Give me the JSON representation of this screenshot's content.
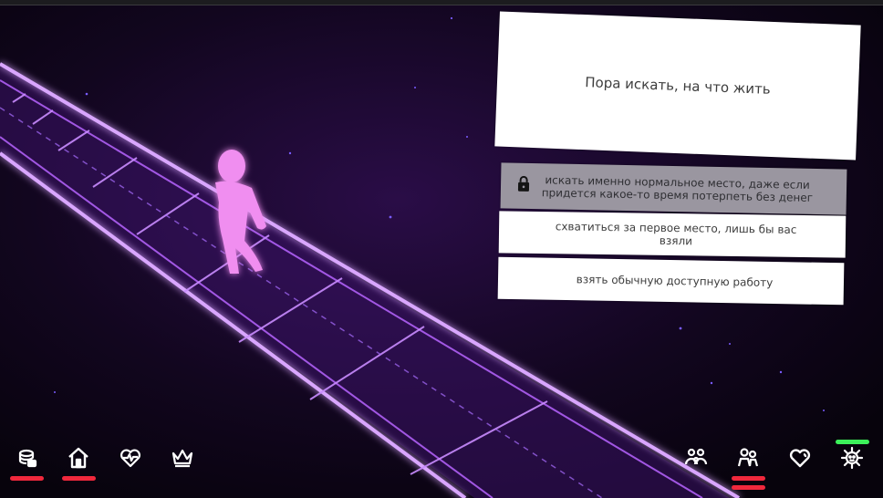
{
  "prompt": {
    "text": "Пора искать, на что жить"
  },
  "choices": [
    {
      "text": "искать именно нормальное место, даже если придется какое-то время потерпеть без денег",
      "locked": true,
      "icon": "lock-icon"
    },
    {
      "text": "схватиться за первое место, лишь бы вас взяли",
      "locked": false
    },
    {
      "text": "взять обычную доступную работу",
      "locked": false
    }
  ],
  "hud": {
    "left": [
      {
        "icon": "money-stack-icon",
        "indicator": "red"
      },
      {
        "icon": "home-icon",
        "indicator": "red"
      },
      {
        "icon": "heartbeat-icon",
        "indicator": "none"
      },
      {
        "icon": "crown-icon",
        "indicator": "none"
      }
    ],
    "right": [
      {
        "icon": "family-icon",
        "indicator": "none"
      },
      {
        "icon": "people-icon",
        "indicator": "red-double"
      },
      {
        "icon": "heart-icon",
        "indicator": "none"
      },
      {
        "icon": "settings-gear-icon",
        "indicator": "green"
      }
    ]
  },
  "colors": {
    "background": "#0a0412",
    "neon": "#b764ff",
    "character": "#f08ef0",
    "indicator_red": "#f0283c",
    "indicator_green": "#3cf05a",
    "locked_choice": "#9a96a0"
  }
}
